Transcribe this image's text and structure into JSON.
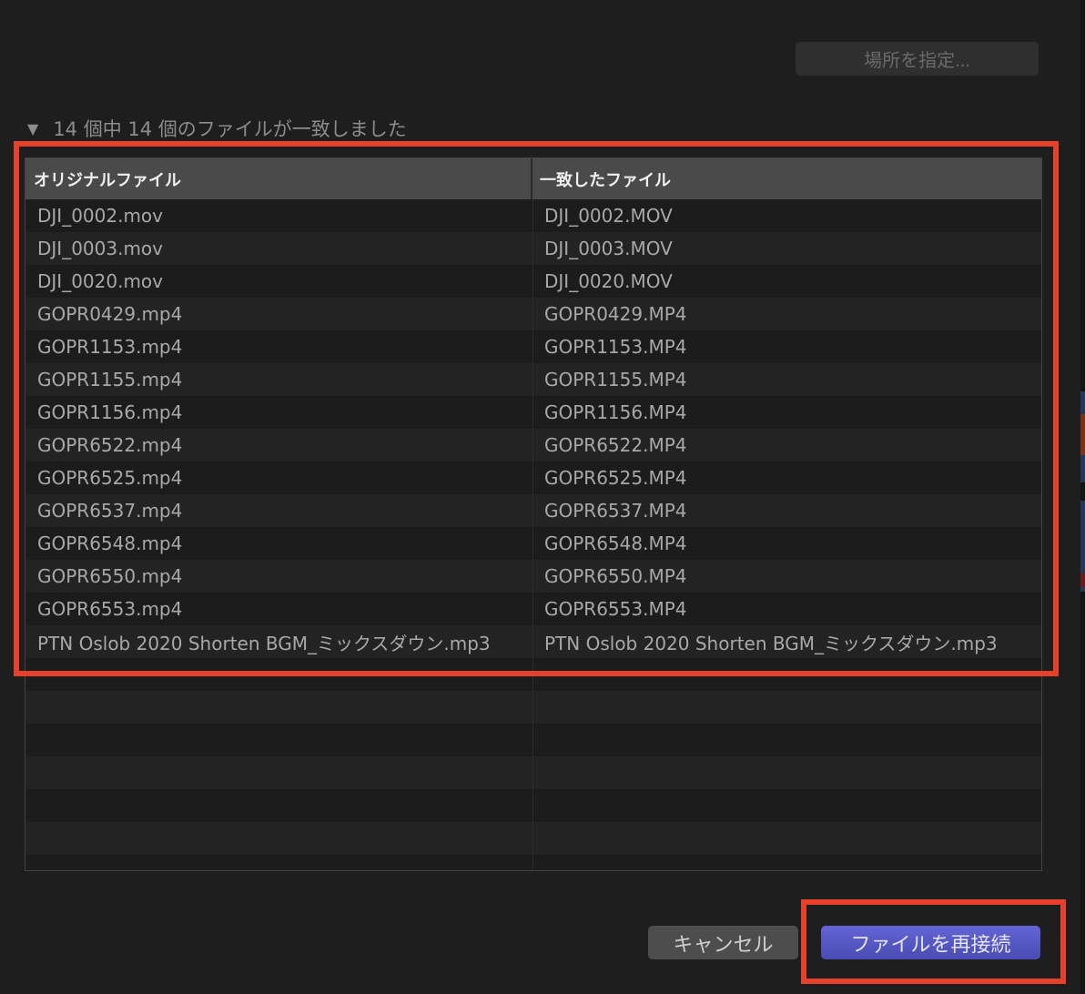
{
  "header": {
    "locate_button": "場所を指定..."
  },
  "summary": {
    "disclosure_icon": "triangle-down-icon",
    "text": "14 個中 14 個のファイルが一致しました"
  },
  "table": {
    "columns": [
      "オリジナルファイル",
      "一致したファイル"
    ],
    "rows": [
      [
        "DJI_0002.mov",
        "DJI_0002.MOV"
      ],
      [
        "DJI_0003.mov",
        "DJI_0003.MOV"
      ],
      [
        "DJI_0020.mov",
        "DJI_0020.MOV"
      ],
      [
        "GOPR0429.mp4",
        "GOPR0429.MP4"
      ],
      [
        "GOPR1153.mp4",
        "GOPR1153.MP4"
      ],
      [
        "GOPR1155.mp4",
        "GOPR1155.MP4"
      ],
      [
        "GOPR1156.mp4",
        "GOPR1156.MP4"
      ],
      [
        "GOPR6522.mp4",
        "GOPR6522.MP4"
      ],
      [
        "GOPR6525.mp4",
        "GOPR6525.MP4"
      ],
      [
        "GOPR6537.mp4",
        "GOPR6537.MP4"
      ],
      [
        "GOPR6548.mp4",
        "GOPR6548.MP4"
      ],
      [
        "GOPR6550.mp4",
        "GOPR6550.MP4"
      ],
      [
        "GOPR6553.mp4",
        "GOPR6553.MP4"
      ],
      [
        "PTN Oslob 2020 Shorten BGM_ミックスダウン.mp3",
        "PTN Oslob 2020 Shorten BGM_ミックスダウン.mp3"
      ]
    ]
  },
  "footer": {
    "cancel": "キャンセル",
    "reconnect": "ファイルを再接続"
  },
  "colors": {
    "highlight": "#e8412b",
    "primary": "#5658c4"
  }
}
